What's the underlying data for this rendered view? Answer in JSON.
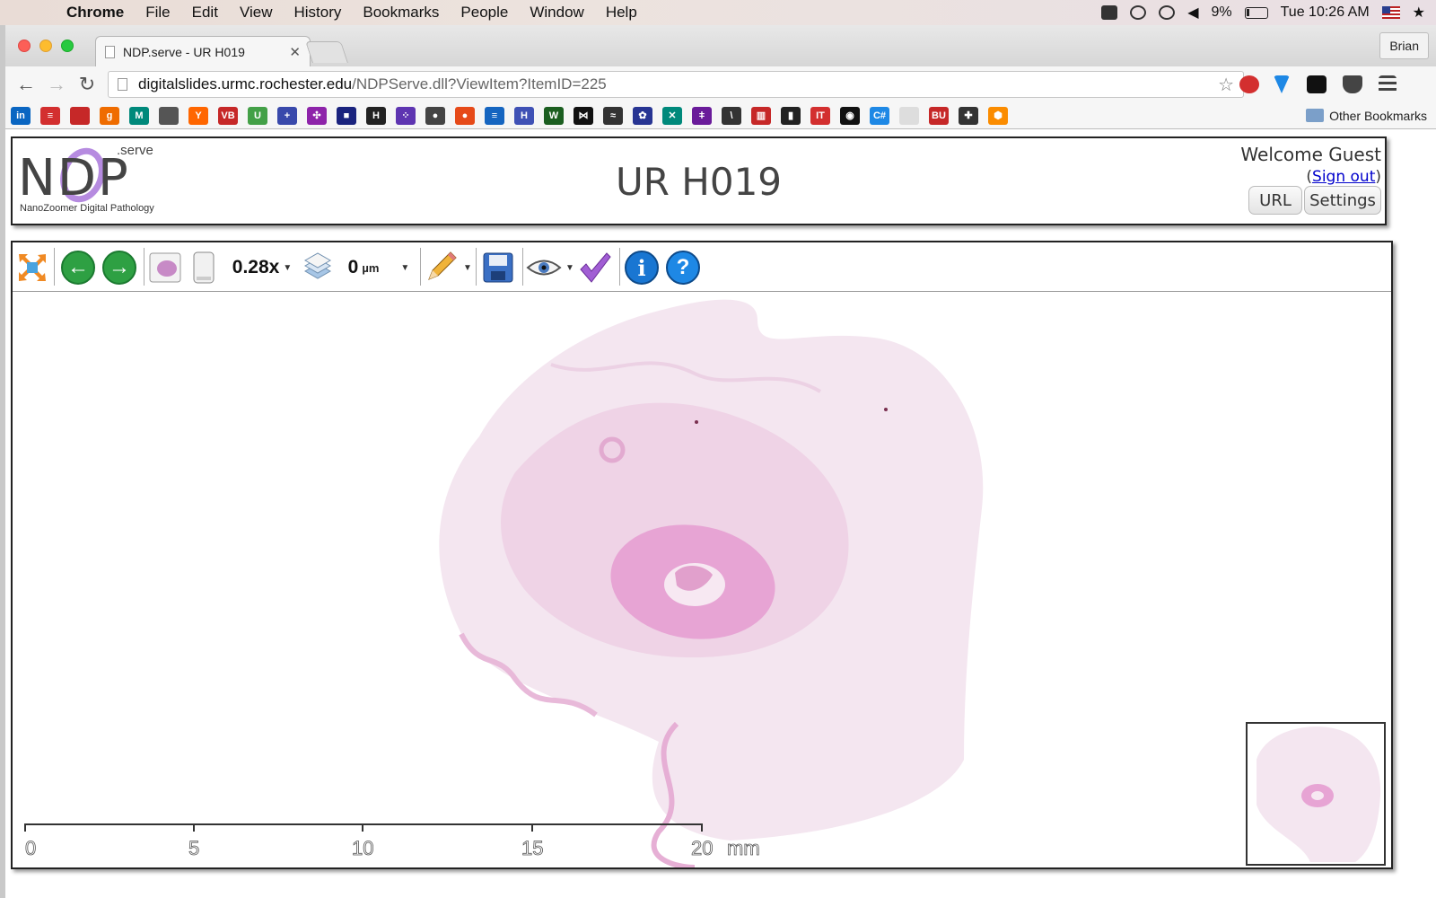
{
  "menubar": {
    "app": "Chrome",
    "items": [
      "File",
      "Edit",
      "View",
      "History",
      "Bookmarks",
      "People",
      "Window",
      "Help"
    ],
    "battery": "9%",
    "clock": "Tue 10:26 AM"
  },
  "browser": {
    "tab_title": "NDP.serve - UR H019",
    "profile": "Brian",
    "url_host": "digitalslides.urmc.rochester.edu",
    "url_path": "/NDPServe.dll?ViewItem?ItemID=225",
    "other_bookmarks": "Other Bookmarks"
  },
  "bookmarks": [
    {
      "label": "in",
      "color": "#0a66c2"
    },
    {
      "label": "≡",
      "color": "#d32f2f"
    },
    {
      "label": "",
      "color": "#c62828"
    },
    {
      "label": "g",
      "color": "#ef6c00"
    },
    {
      "label": "M",
      "color": "#00897b"
    },
    {
      "label": "",
      "color": "#555555"
    },
    {
      "label": "Y",
      "color": "#ff6600"
    },
    {
      "label": "VB",
      "color": "#c62828"
    },
    {
      "label": "U",
      "color": "#43a047"
    },
    {
      "label": "+",
      "color": "#3949ab"
    },
    {
      "label": "✣",
      "color": "#8e24aa"
    },
    {
      "label": "■",
      "color": "#1a237e"
    },
    {
      "label": "H",
      "color": "#222222"
    },
    {
      "label": "⁘",
      "color": "#5e35b1"
    },
    {
      "label": "●",
      "color": "#444444"
    },
    {
      "label": "●",
      "color": "#e64a19"
    },
    {
      "label": "≡",
      "color": "#1565c0"
    },
    {
      "label": "H",
      "color": "#3f51b5"
    },
    {
      "label": "W",
      "color": "#1b5e20"
    },
    {
      "label": "⋈",
      "color": "#111111"
    },
    {
      "label": "≈",
      "color": "#333333"
    },
    {
      "label": "✿",
      "color": "#283593"
    },
    {
      "label": "✕",
      "color": "#00897b"
    },
    {
      "label": "ǂ",
      "color": "#6a1b9a"
    },
    {
      "label": "\\",
      "color": "#333333"
    },
    {
      "label": "▥",
      "color": "#c62828"
    },
    {
      "label": "▮",
      "color": "#222222"
    },
    {
      "label": "IT",
      "color": "#d32f2f"
    },
    {
      "label": "◉",
      "color": "#111111"
    },
    {
      "label": "C#",
      "color": "#1e88e5"
    },
    {
      "label": "",
      "color": "#dddddd"
    },
    {
      "label": "BU",
      "color": "#c62828"
    },
    {
      "label": "✚",
      "color": "#333333"
    },
    {
      "label": "⬢",
      "color": "#fb8c00"
    }
  ],
  "page": {
    "logo_serve": ".serve",
    "logo_text": "NDP",
    "logo_tagline": "NanoZoomer Digital Pathology",
    "slide_title": "UR H019",
    "welcome": "Welcome Guest",
    "signout_open": "(",
    "signout_label": "Sign out",
    "signout_close": ")",
    "url_button": "URL",
    "settings_button": "Settings"
  },
  "viewer": {
    "zoom": "0.28x",
    "focus_value": "0",
    "focus_unit": "µm",
    "scale_ticks": [
      "0",
      "5",
      "10",
      "15",
      "20"
    ],
    "scale_unit": "mm"
  },
  "colors": {
    "tissue_pink": "#e7a4d4",
    "tissue_light": "#f4e4f0",
    "nav_green": "#2ea043",
    "info_blue": "#1976d2",
    "logo_purple": "#b68be0"
  }
}
